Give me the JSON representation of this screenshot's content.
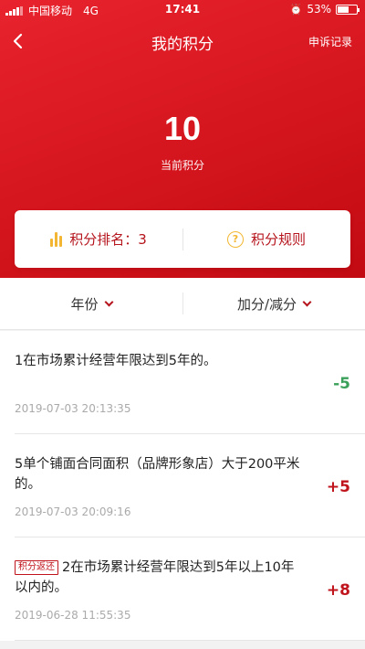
{
  "status_bar": {
    "carrier": "中国移动",
    "network": "4G",
    "time": "17:41",
    "battery": "53%",
    "battery_level": 0.53
  },
  "nav": {
    "title": "我的积分",
    "right_link": "申诉记录"
  },
  "score": {
    "value": "10",
    "label": "当前积分"
  },
  "card": {
    "rank_label": "积分排名：3",
    "rules_label": "积分规则"
  },
  "filters": {
    "year": "年份",
    "type": "加分/减分"
  },
  "records": [
    {
      "tag": "",
      "description": "1在市场累计经营年限达到5年的。",
      "time": "2019-07-03 20:13:35",
      "points": "-5",
      "sign": "neg"
    },
    {
      "tag": "",
      "description": "5单个铺面合同面积（品牌形象店）大于200平米的。",
      "time": "2019-07-03 20:09:16",
      "points": "+5",
      "sign": "pos"
    },
    {
      "tag": "积分返还",
      "description": "2在市场累计经营年限达到5年以上10年以内的。",
      "time": "2019-06-28 11:55:35",
      "points": "+8",
      "sign": "pos"
    }
  ],
  "colors": {
    "brand_red": "#d4151d",
    "accent_gold": "#f2b632",
    "positive": "#c0141c",
    "negative": "#3aa05a"
  }
}
